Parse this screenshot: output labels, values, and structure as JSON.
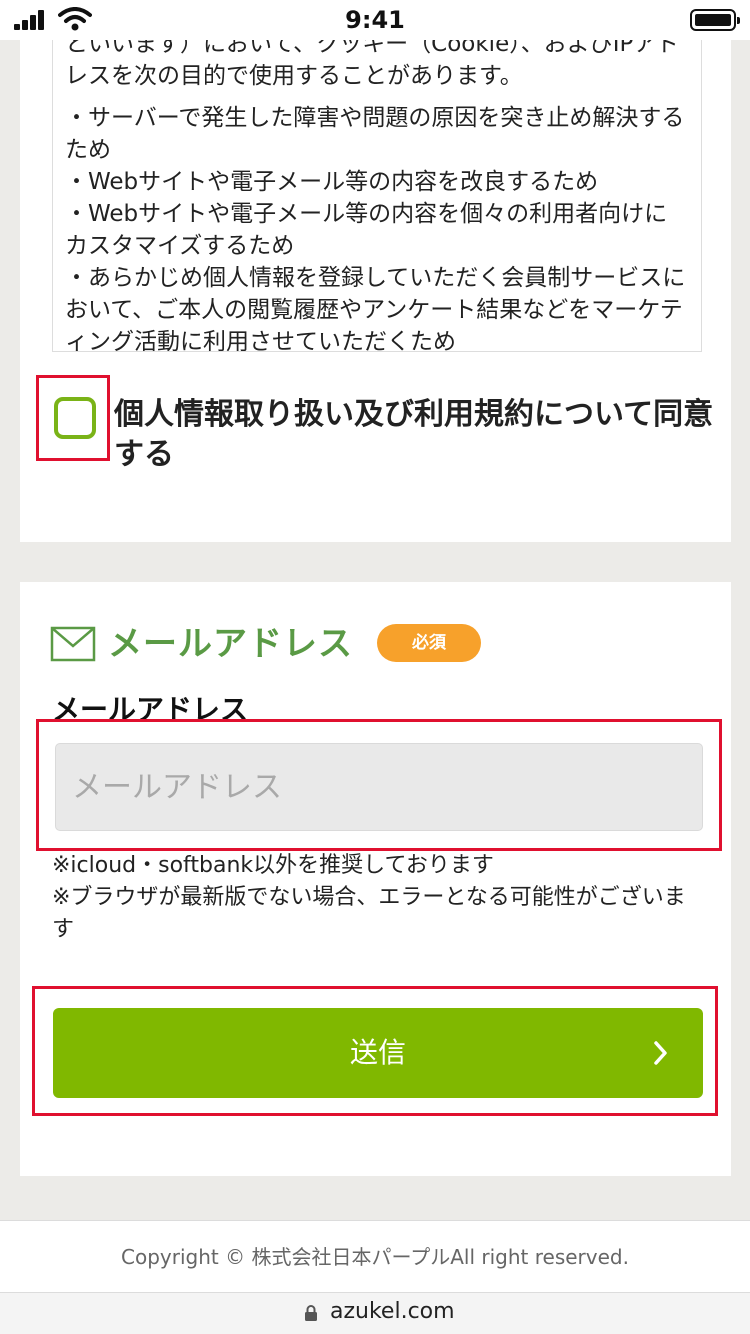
{
  "status_bar": {
    "time": "9:41"
  },
  "privacy": {
    "intro": "といいます）において、クッキー（Cookie）、およびIPアドレスを次の目的で使用することがあります。",
    "items": [
      "・サーバーで発生した障害や問題の原因を突き止め解決するため",
      "・Webサイトや電子メール等の内容を改良するため",
      "・Webサイトや電子メール等の内容を個々の利用者向けにカスタマイズするため",
      "・あらかじめ個人情報を登録していただく会員制サービスにおいて、ご本人の閲覧履歴やアンケート結果などをマーケティング活動に利用させていただくため"
    ]
  },
  "consent": {
    "label": "個人情報取り扱い及び利用規約について同意する",
    "checked": false
  },
  "form": {
    "section_title": "メールアドレス",
    "required_badge": "必須",
    "field_label": "メールアドレス",
    "email_placeholder": "メールアドレス",
    "email_value": "",
    "notes": [
      "※icloud・softbank以外を推奨しております",
      "※ブラウザが最新版でない場合、エラーとなる可能性がございます"
    ],
    "submit_label": "送信"
  },
  "footer": {
    "copyright": "Copyright © 株式会社日本パープルAll right reserved."
  },
  "browser": {
    "url": "azukel.com"
  },
  "colors": {
    "accent_green": "#80b800",
    "title_green": "#5a9a45",
    "badge_orange": "#f7a12b",
    "highlight_red": "#e0102f"
  },
  "icons": {
    "section": "envelope-icon",
    "submit": "chevron-right-icon",
    "url": "lock-icon"
  }
}
